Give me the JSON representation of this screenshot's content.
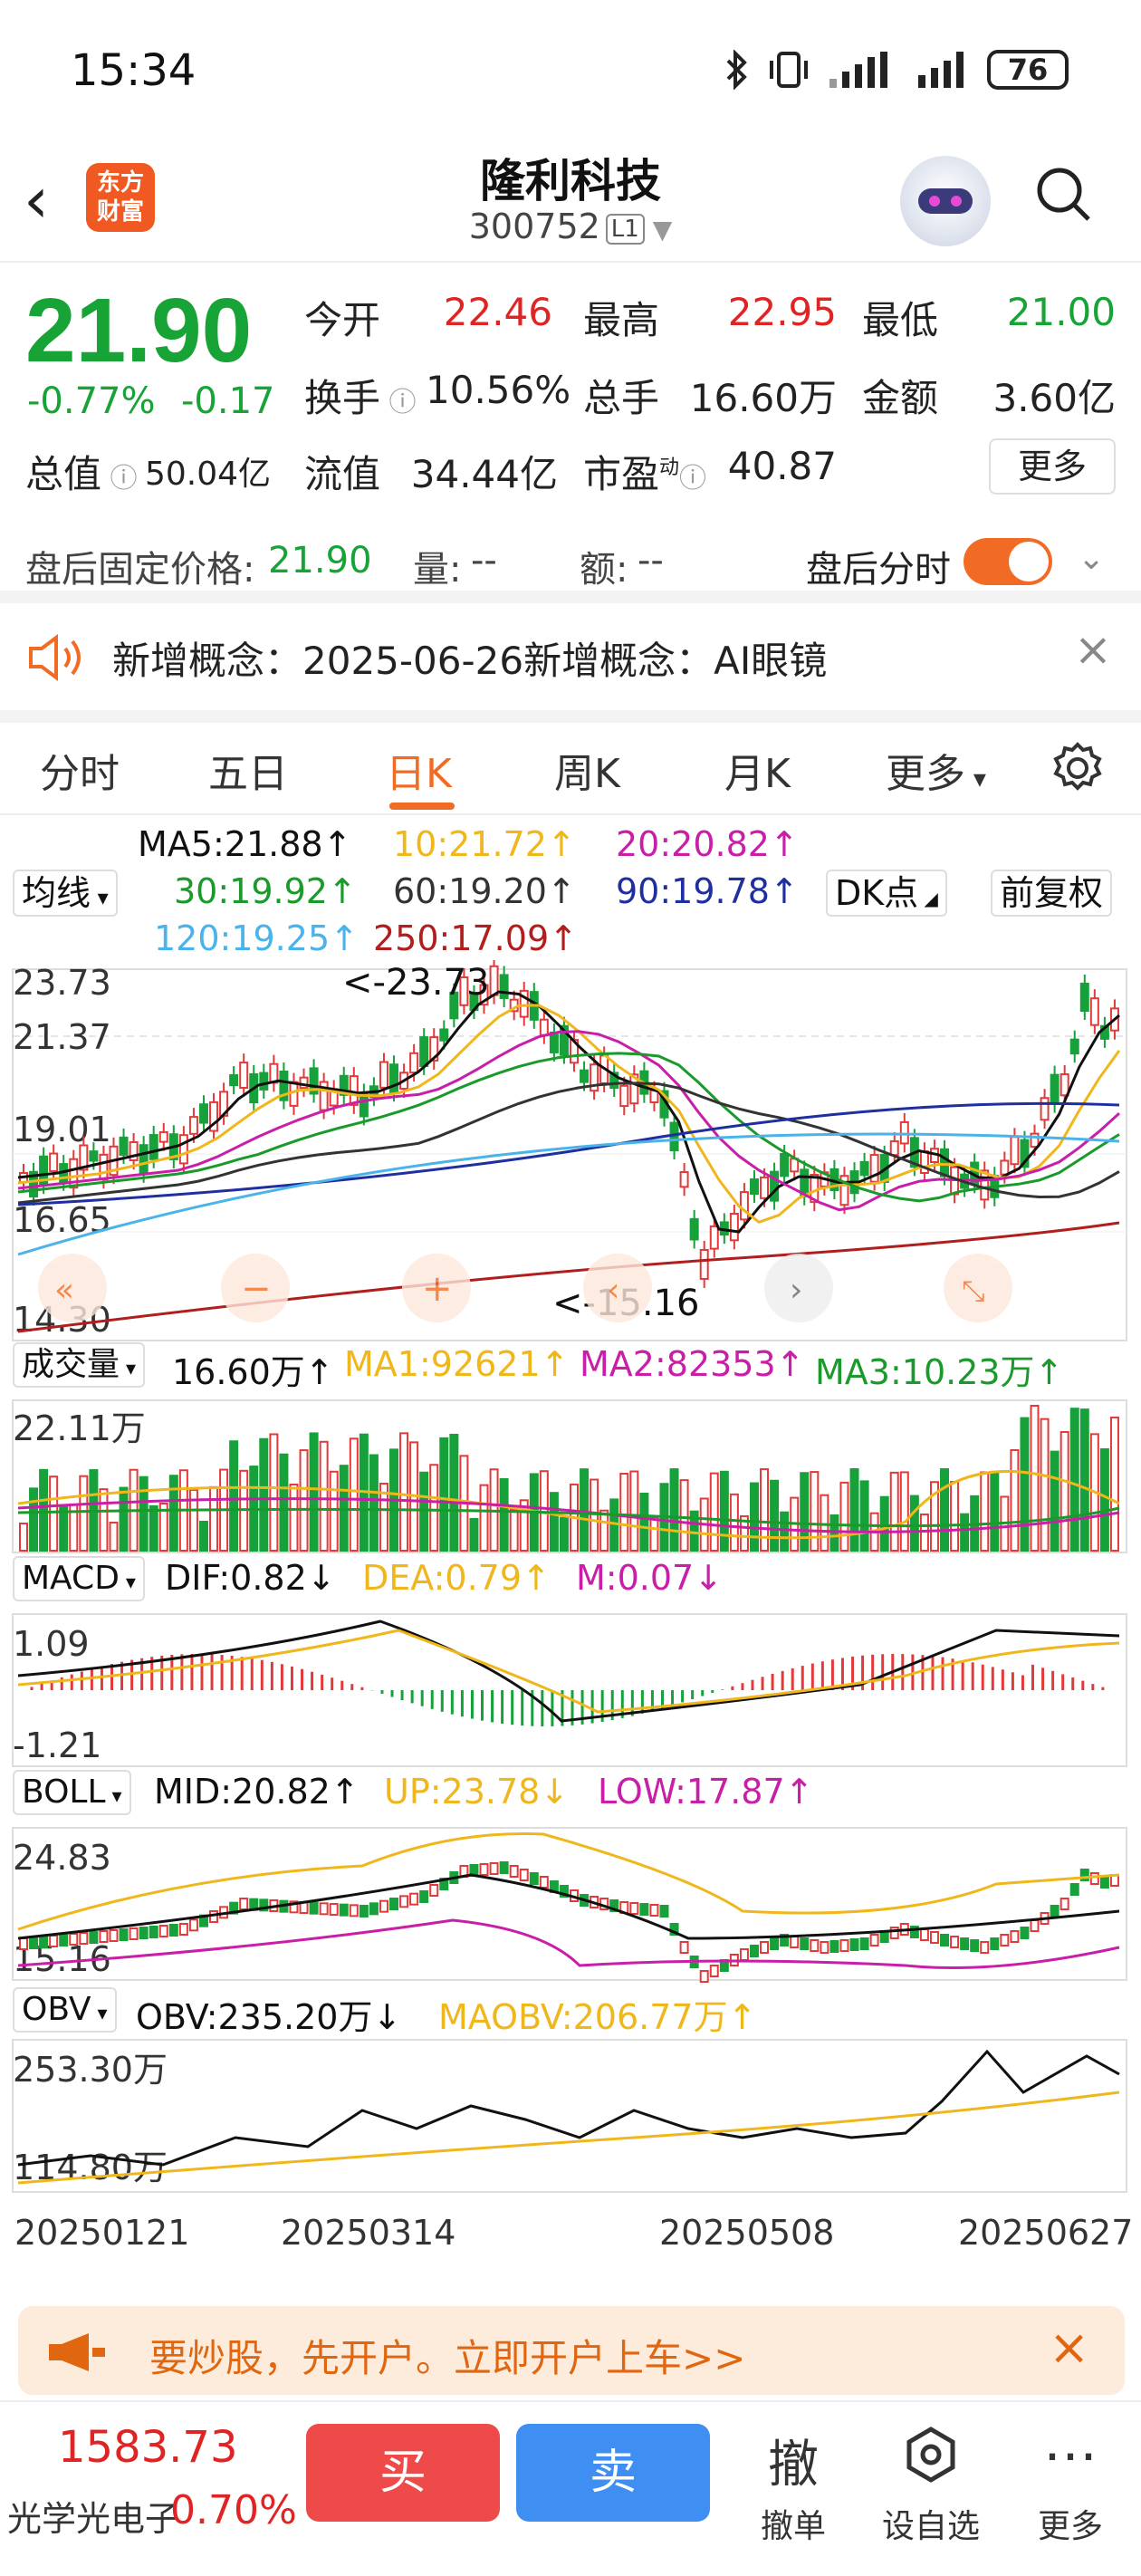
{
  "status": {
    "time": "15:34",
    "battery": "76"
  },
  "header": {
    "title": "隆利科技",
    "code": "300752",
    "level": "L1",
    "logo_text": "东方财富"
  },
  "quote": {
    "price": "21.90",
    "chg_pct": "-0.77%",
    "chg": "-0.17",
    "open_label": "今开",
    "open": "22.46",
    "high_label": "最高",
    "high": "22.95",
    "low_label": "最低",
    "low": "21.00",
    "turnover_label": "换手",
    "turnover": "10.56%",
    "volume_label": "总手",
    "volume": "16.60万",
    "amount_label": "金额",
    "amount": "3.60亿",
    "mcap_label": "总值",
    "mcap": "50.04亿",
    "float_label": "流值",
    "float": "34.44亿",
    "pe_label": "市盈",
    "pe_sup": "动",
    "pe": "40.87",
    "more": "更多"
  },
  "afterhours": {
    "label": "盘后固定价格:",
    "price": "21.90",
    "vol_label": "量:",
    "vol": "--",
    "amt_label": "额:",
    "amt": "--",
    "timeshare": "盘后分时"
  },
  "news": {
    "text": "新增概念：2025-06-26新增概念：AI眼镜"
  },
  "tabs": [
    "分时",
    "五日",
    "日K",
    "周K",
    "月K",
    "更多"
  ],
  "ma": {
    "selector": "均线",
    "ma5": "MA5:21.88↑",
    "ma10": "10:21.72↑",
    "ma20": "20:20.82↑",
    "ma30": "30:19.92↑",
    "ma60": "60:19.20↑",
    "ma90": "90:19.78↑",
    "ma120": "120:19.25↑",
    "ma250": "250:17.09↑",
    "dk": "DK点",
    "adjust": "前复权"
  },
  "kline": {
    "y_labels": [
      "23.73",
      "21.37",
      "19.01",
      "16.65",
      "14.30"
    ],
    "hi_mark": "<-23.73",
    "lo_mark": "<-15.16"
  },
  "volume": {
    "selector": "成交量",
    "value": "16.60万↑",
    "ma1": "MA1:92621↑",
    "ma2": "MA2:82353↑",
    "ma3": "MA3:10.23万↑",
    "y_top": "22.11万"
  },
  "macd": {
    "selector": "MACD",
    "dif": "DIF:0.82↓",
    "dea": "DEA:0.79↑",
    "m": "M:0.07↓",
    "y_top": "1.09",
    "y_bot": "-1.21"
  },
  "boll": {
    "selector": "BOLL",
    "mid": "MID:20.82↑",
    "up": "UP:23.78↓",
    "low": "LOW:17.87↑",
    "y_top": "24.83",
    "y_bot": "15.16"
  },
  "obv": {
    "selector": "OBV",
    "obv": "OBV:235.20万↓",
    "maobv": "MAOBV:206.77万↑",
    "y_top": "253.30万",
    "y_bot": "114.80万"
  },
  "dates": [
    "20250121",
    "20250314",
    "20250508",
    "20250627"
  ],
  "ad": {
    "text": "要炒股，先开户。立即开户上车>>"
  },
  "bottom": {
    "index_value": "1583.73",
    "index_name": "光学光电子",
    "index_pct": "0.70%",
    "buy": "买",
    "sell": "卖",
    "cancel": "撤单",
    "cancel_icon": "撤",
    "watch": "设自选",
    "more": "更多"
  }
}
